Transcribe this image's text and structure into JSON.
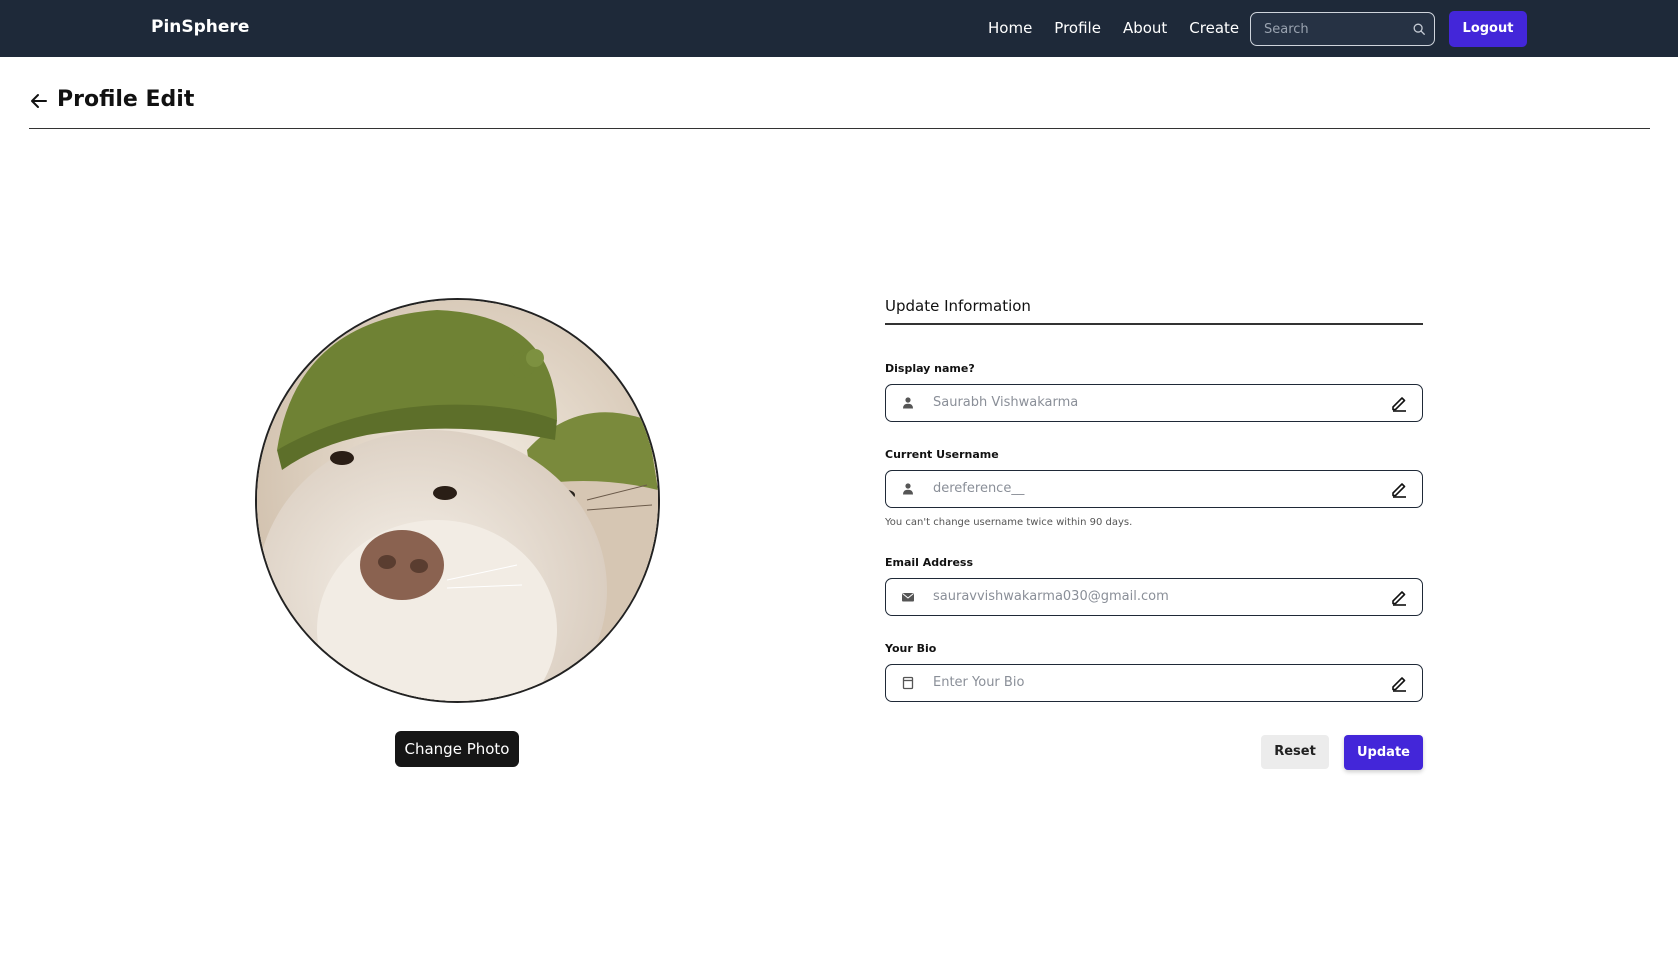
{
  "navbar": {
    "brand": "PinSphere",
    "links": [
      "Home",
      "Profile",
      "About",
      "Create"
    ],
    "search_placeholder": "Search",
    "logout_label": "Logout"
  },
  "page": {
    "title": "Profile Edit"
  },
  "avatar": {
    "change_photo_label": "Change Photo"
  },
  "form": {
    "title": "Update Information",
    "display_name": {
      "label": "Display name?",
      "value": "Saurabh Vishwakarma",
      "icon": "user-icon"
    },
    "username": {
      "label": "Current Username",
      "value": "dereference__",
      "icon": "user-icon",
      "helper": "You can't change username twice within 90 days."
    },
    "email": {
      "label": "Email Address",
      "value": "sauravvishwakarma030@gmail.com",
      "icon": "envelope-icon"
    },
    "bio": {
      "label": "Your Bio",
      "placeholder": "Enter Your Bio",
      "icon": "notebook-icon"
    },
    "reset_label": "Reset",
    "update_label": "Update"
  },
  "colors": {
    "navbar_bg": "#1e2939",
    "accent": "#4326d9",
    "dark_button": "#161616"
  }
}
